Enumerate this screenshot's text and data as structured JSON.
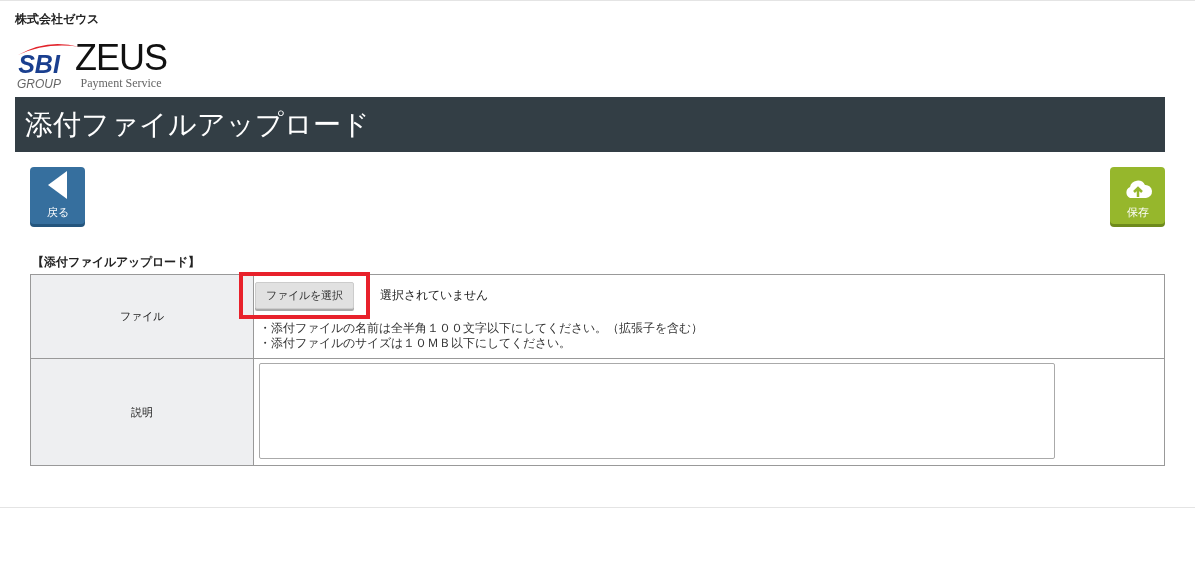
{
  "company": "株式会社ゼウス",
  "logo": {
    "mark": "SBI",
    "group": "GROUP",
    "brand": "ZEUS",
    "tagline": "Payment Service"
  },
  "title": "添付ファイルアップロード",
  "toolbar": {
    "back": "戻る",
    "save": "保存"
  },
  "section_label": "【添付ファイルアップロード】",
  "form": {
    "file_label": "ファイル",
    "file_button": "ファイルを選択",
    "file_status": "選択されていません",
    "notes": [
      "・添付ファイルの名前は全半角１００文字以下にしてください。（拡張子を含む）",
      "・添付ファイルのサイズは１０ＭＢ以下にしてください。"
    ],
    "description_label": "説明"
  },
  "file_button_highlighted": true
}
